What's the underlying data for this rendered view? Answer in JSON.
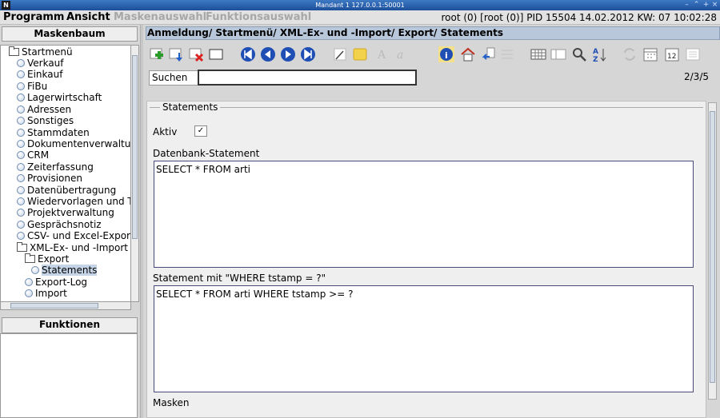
{
  "window": {
    "title": "Mandant 1 127.0.0.1:50001",
    "logo": "N"
  },
  "menubar": {
    "items": [
      "Programm",
      "Ansicht"
    ],
    "disabled_items": [
      "Maskenauswahl",
      "Funktionsauswahl"
    ],
    "status": "root (0) [root (0)] PID 15504 14.02.2012 KW: 07 10:02:28"
  },
  "left": {
    "maskenbaum_title": "Maskenbaum",
    "funktionen_title": "Funktionen",
    "tree": {
      "root": "Startmenü",
      "items": [
        "Verkauf",
        "Einkauf",
        "FiBu",
        "Lagerwirtschaft",
        "Adressen",
        "Sonstiges",
        "Stammdaten",
        "Dokumentenverwaltung",
        "CRM",
        "Zeiterfassung",
        "Provisionen",
        "Datenübertragung",
        "Wiedervorlagen und Termine",
        "Projektverwaltung",
        "Gesprächsnotiz",
        "CSV- und Excel-Export"
      ],
      "xml_folder": "XML-Ex- und -Import",
      "export_folder": "Export",
      "selected": "Statements",
      "after": [
        "Export-Log",
        "Import"
      ]
    }
  },
  "right": {
    "breadcrumb": "Anmeldung/ Startmenü/ XML-Ex- und -Import/ Export/ Statements",
    "search": {
      "label": "Suchen",
      "value": "",
      "page": "2/3/5"
    },
    "form": {
      "group": "Statements",
      "aktiv_label": "Aktiv",
      "aktiv_checked": true,
      "db_label": "Datenbank-Statement",
      "db_value": "SELECT * FROM arti",
      "where_label": "Statement mit \"WHERE tstamp = ?\"",
      "where_value": "SELECT * FROM arti WHERE tstamp >= ?",
      "masken_label": "Masken"
    },
    "toolbar_icons": [
      "add-icon",
      "save-icon",
      "delete-icon",
      "blank-icon",
      "first-icon",
      "prev-icon",
      "next-icon",
      "last-icon",
      "edit-icon",
      "note-icon",
      "font-icon",
      "font-italic-icon",
      "info-icon",
      "home-icon",
      "import-icon",
      "export-icon",
      "table-icon",
      "panel-icon",
      "search-icon",
      "sort-az-icon",
      "refresh-icon",
      "calendar-icon",
      "calendar-12-icon",
      "list-icon"
    ],
    "calendar_day": "12"
  },
  "colors": {
    "titlebar": "#1d4f9a",
    "nav_blue": "#1f4fb4",
    "breadcrumb": "#b8c7d9"
  }
}
